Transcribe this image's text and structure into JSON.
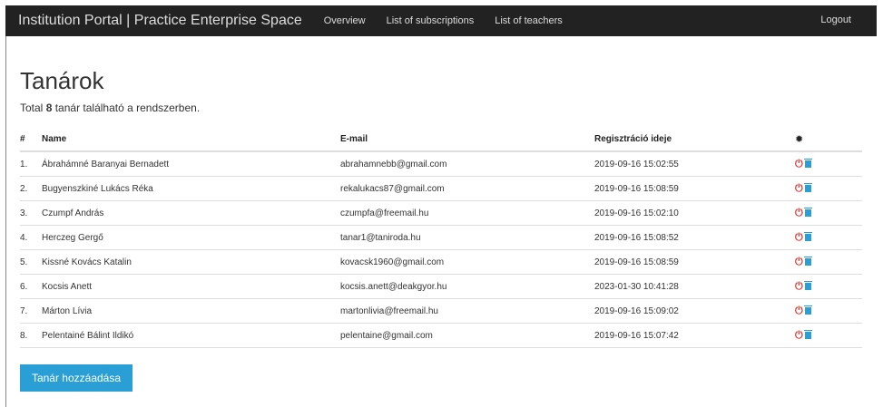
{
  "navbar": {
    "brand": "Institution Portal | Practice Enterprise Space",
    "links": [
      "Overview",
      "List of subscriptions",
      "List of teachers"
    ],
    "logout": "Logout"
  },
  "page": {
    "title": "Tanárok",
    "summary_prefix": "Total ",
    "summary_count": "8",
    "summary_suffix": " tanár található a rendszerben."
  },
  "table": {
    "headers": {
      "num": "#",
      "name": "Name",
      "email": "E-mail",
      "date": "Regisztráció ideje",
      "actions_icon": "gear-icon"
    },
    "rows": [
      {
        "num": "1.",
        "name": "Ábrahámné Baranyai Bernadett",
        "email": "abrahamnebb@gmail.com",
        "date": "2019-09-16 15:02:55"
      },
      {
        "num": "2.",
        "name": "Bugyenszkiné Lukács Réka",
        "email": "rekalukacs87@gmail.com",
        "date": "2019-09-16 15:08:59"
      },
      {
        "num": "3.",
        "name": "Czumpf András",
        "email": "czumpfa@freemail.hu",
        "date": "2019-09-16 15:02:10"
      },
      {
        "num": "4.",
        "name": "Herczeg Gergő",
        "email": "tanar1@taniroda.hu",
        "date": "2019-09-16 15:08:52"
      },
      {
        "num": "5.",
        "name": "Kissné Kovács Katalin",
        "email": "kovacsk1960@gmail.com",
        "date": "2019-09-16 15:08:59"
      },
      {
        "num": "6.",
        "name": "Kocsis Anett",
        "email": "kocsis.anett@deakgyor.hu",
        "date": "2023-01-30 10:41:28"
      },
      {
        "num": "7.",
        "name": "Márton Lívia",
        "email": "martonlivia@freemail.hu",
        "date": "2019-09-16 15:09:02"
      },
      {
        "num": "8.",
        "name": "Pelentainé Bálint Ildikó",
        "email": "pelentaine@gmail.com",
        "date": "2019-09-16 15:07:42"
      }
    ]
  },
  "add_button": "Tanár hozzáadása",
  "colors": {
    "navbar": "#222222",
    "accent": "#2a9fd6",
    "danger": "#e53935"
  }
}
